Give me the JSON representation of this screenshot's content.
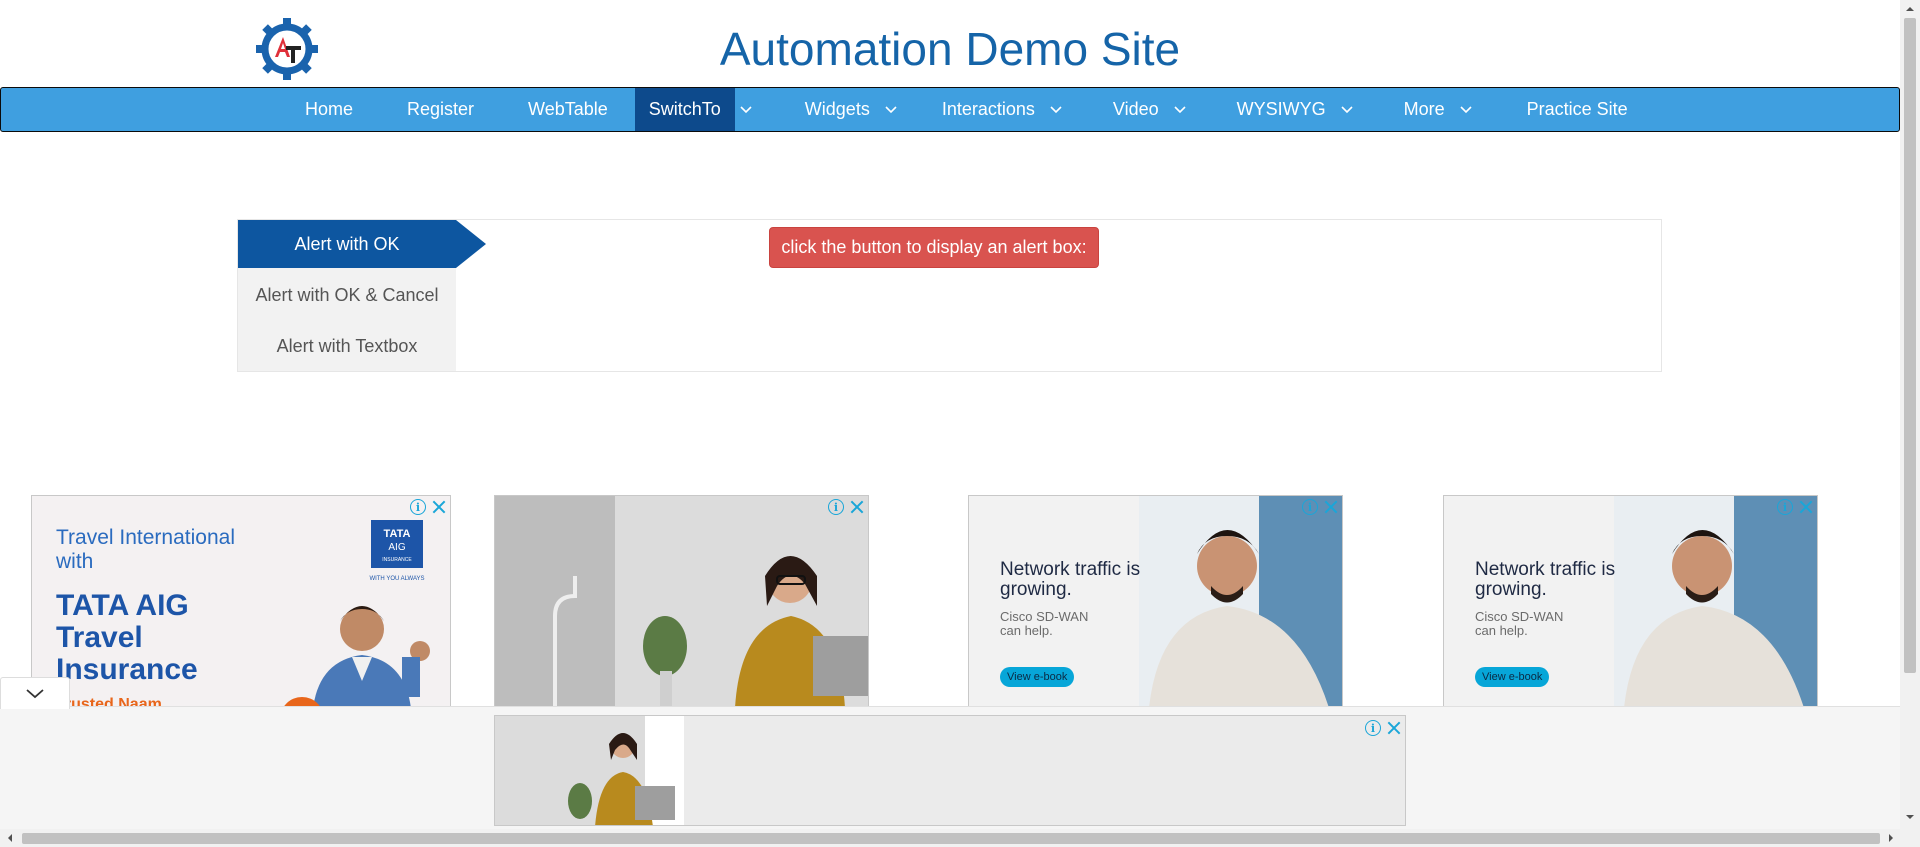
{
  "site": {
    "title": "Automation Demo Site"
  },
  "nav": {
    "items": [
      {
        "label": "Home",
        "dropdown": false,
        "active": false
      },
      {
        "label": "Register",
        "dropdown": false,
        "active": false
      },
      {
        "label": "WebTable",
        "dropdown": false,
        "active": false
      },
      {
        "label": "SwitchTo",
        "dropdown": true,
        "active": true
      },
      {
        "label": "Widgets",
        "dropdown": true,
        "active": false
      },
      {
        "label": "Interactions",
        "dropdown": true,
        "active": false
      },
      {
        "label": "Video",
        "dropdown": true,
        "active": false
      },
      {
        "label": "WYSIWYG",
        "dropdown": true,
        "active": false
      },
      {
        "label": "More",
        "dropdown": true,
        "active": false
      },
      {
        "label": "Practice Site",
        "dropdown": false,
        "active": false
      }
    ]
  },
  "alerts": {
    "tabs": [
      {
        "label": "Alert with OK",
        "active": true
      },
      {
        "label": "Alert with OK & Cancel",
        "active": false
      },
      {
        "label": "Alert with Textbox",
        "active": false
      }
    ],
    "button_label": "click the button to display an alert box:"
  },
  "ads": {
    "ad1": {
      "line1": "Travel International with",
      "line2": "TATA AIG Travel Insurance",
      "line3": "Trusted Naam",
      "brand": "TATA AIG INSURANCE",
      "brand_tagline": "WITH YOU ALWAYS"
    },
    "ad3": {
      "headline": "Network traffic is growing.",
      "sub": "Cisco SD-WAN can help.",
      "cta": "View e-book"
    },
    "ad4": {
      "headline": "Network traffic is growing.",
      "sub": "Cisco SD-WAN can help.",
      "cta": "View e-book"
    }
  },
  "colors": {
    "nav_bg": "#3f9fe0",
    "nav_active": "#0d4a8c",
    "title": "#1564a8",
    "tab_active": "#0d56a0",
    "alert_button": "#d9534f",
    "ad_accent": "#1aa6d8"
  },
  "icons": {
    "logo": "gear-at-logo-icon",
    "caret": "chevron-down-icon",
    "ad_info": "info-icon",
    "ad_close": "close-icon",
    "sticky_toggle": "chevron-down-icon"
  }
}
